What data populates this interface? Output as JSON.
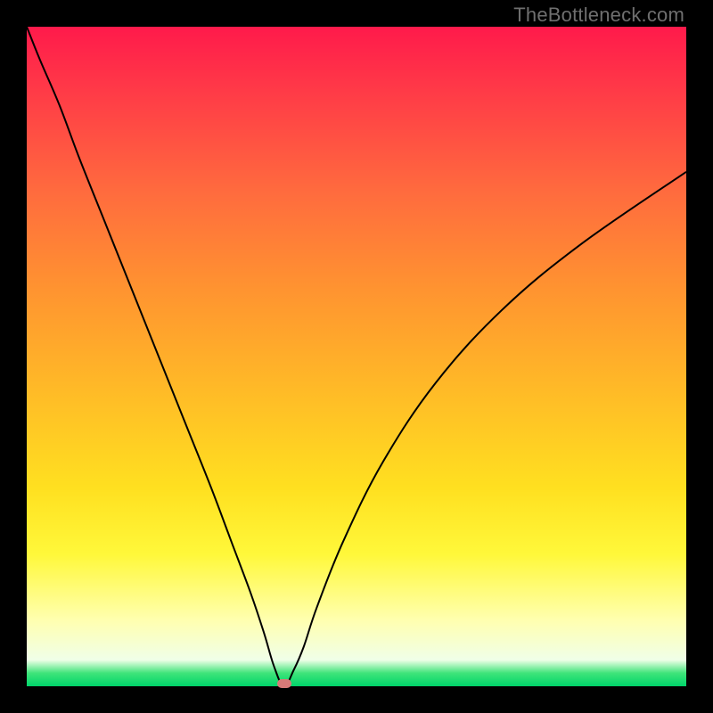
{
  "watermark": "TheBottleneck.com",
  "colors": {
    "frame": "#000000",
    "gradient_top": "#ff1a4b",
    "gradient_bottom": "#00d56a",
    "curve": "#000000",
    "marker": "#d87a78",
    "watermark_text": "#6f6f6f"
  },
  "chart_data": {
    "type": "line",
    "title": "",
    "xlabel": "",
    "ylabel": "",
    "xlim": [
      0,
      100
    ],
    "ylim": [
      0,
      100
    ],
    "grid": false,
    "legend": false,
    "series": [
      {
        "name": "bottleneck-curve",
        "x": [
          0,
          2,
          5,
          8,
          12,
          16,
          20,
          24,
          28,
          31,
          34,
          36,
          37.5,
          39,
          40.5,
          42,
          44,
          48,
          54,
          62,
          72,
          84,
          100
        ],
        "values": [
          100,
          95,
          88,
          80,
          70,
          60,
          50,
          40,
          30,
          22,
          14,
          8,
          3,
          0,
          2.5,
          6,
          12,
          22,
          34,
          46,
          57,
          67,
          78
        ]
      }
    ],
    "marker": {
      "x": 39,
      "y": 0
    },
    "description": "V-shaped curve reaching its minimum (zero bottleneck) near x≈39 on a vertical red→green gradient background."
  }
}
